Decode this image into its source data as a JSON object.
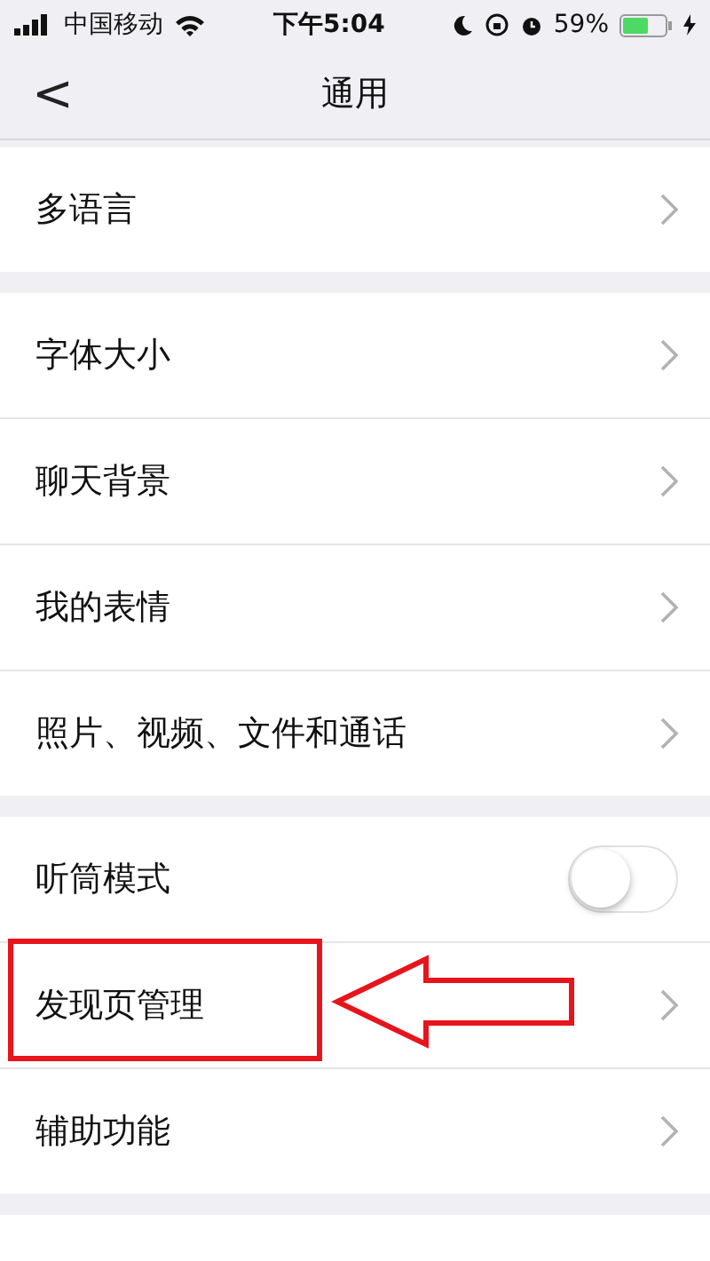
{
  "status_bar": {
    "carrier": "中国移动",
    "time": "下午5:04",
    "battery": "59%"
  },
  "nav": {
    "back": "<",
    "title": "通用"
  },
  "groups": [
    {
      "items": [
        {
          "label": "多语言",
          "kind": "link"
        }
      ]
    },
    {
      "items": [
        {
          "label": "字体大小",
          "kind": "link"
        },
        {
          "label": "聊天背景",
          "kind": "link"
        },
        {
          "label": "我的表情",
          "kind": "link"
        },
        {
          "label": "照片、视频、文件和通话",
          "kind": "link"
        }
      ]
    },
    {
      "items": [
        {
          "label": "听筒模式",
          "kind": "toggle",
          "on": false
        },
        {
          "label": "发现页管理",
          "kind": "link",
          "highlighted": true
        },
        {
          "label": "辅助功能",
          "kind": "link"
        }
      ]
    }
  ]
}
